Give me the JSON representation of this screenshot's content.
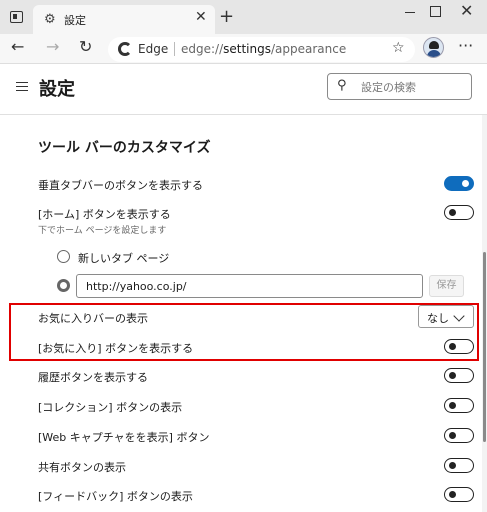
{
  "tab": {
    "title": "設定"
  },
  "address": {
    "label": "Edge",
    "url_prefix": "edge://",
    "url_host": "settings",
    "url_path": "/appearance"
  },
  "header": {
    "title": "設定",
    "search_placeholder": "設定の検索"
  },
  "section": {
    "title": "ツール バーのカスタマイズ"
  },
  "rows": {
    "vertical_tabs": {
      "label": "垂直タブバーのボタンを表示する",
      "on": true
    },
    "home": {
      "label": "[ホーム] ボタンを表示する",
      "sub": "下でホーム ページを設定します",
      "on": false
    },
    "favorites_bar": {
      "label": "お気に入りバーの表示",
      "value": "なし"
    },
    "favorites_btn": {
      "label": "[お気に入り] ボタンを表示する",
      "on": false
    },
    "history": {
      "label": "履歴ボタンを表示する",
      "on": false
    },
    "collections": {
      "label": "[コレクション] ボタンの表示",
      "on": false
    },
    "web_capture": {
      "label": "[Web キャプチャをを表示] ボタン",
      "on": false
    },
    "share": {
      "label": "共有ボタンの表示",
      "on": false
    },
    "feedback": {
      "label": "[フィードバック] ボタンの表示",
      "on": false
    }
  },
  "home_options": {
    "new_tab_label": "新しいタブ ページ",
    "url_value": "http://yahoo.co.jp/",
    "save_label": "保存"
  },
  "colors": {
    "accent": "#0f6cbd",
    "highlight": "#e00000"
  }
}
